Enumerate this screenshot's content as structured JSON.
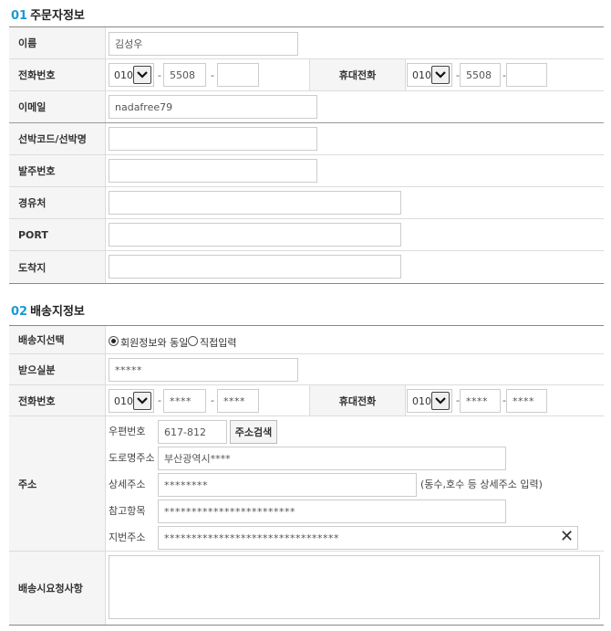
{
  "orderer": {
    "num": "01",
    "title": "주문자정보",
    "name_label": "이름",
    "name_value": "김성우",
    "phone_label": "전화번호",
    "phone": {
      "area": "010",
      "mid": "5508",
      "last": ""
    },
    "mobile_label": "휴대전화",
    "mobile": {
      "area": "010",
      "mid": "5508",
      "last": ""
    },
    "email_label": "이메일",
    "email_value": "nadafree79",
    "ship_code_label": "선박코드/선박명",
    "ship_code_value": "",
    "order_no_label": "발주번호",
    "order_no_value": "",
    "via_label": "경유처",
    "via_value": "",
    "port_label": "PORT",
    "port_value": "",
    "dest_label": "도착지",
    "dest_value": ""
  },
  "shipping": {
    "num": "02",
    "title": "배송지정보",
    "select_label": "배송지선택",
    "option_same": "회원정보와 동일",
    "option_direct": "직접입력",
    "selected": "same",
    "recipient_label": "받으실분",
    "recipient_value": "*****",
    "phone_label": "전화번호",
    "phone": {
      "area": "010",
      "mid": "****",
      "last": "****"
    },
    "mobile_label": "휴대전화",
    "mobile": {
      "area": "010",
      "mid": "****",
      "last": "****"
    },
    "address_label": "주소",
    "zip_label": "우편번호",
    "zip_value": "617-812",
    "zip_button": "주소검색",
    "road_label": "도로명주소",
    "road_value": "부산광역시****",
    "detail_label": "상세주소",
    "detail_value": "********",
    "detail_note": "(동수,호수 등 상세주소 입력)",
    "ref_label": "참고항목",
    "ref_value": "************************",
    "jibun_label": "지번주소",
    "jibun_value": "********************************",
    "request_label": "배송시요청사항",
    "request_value": ""
  },
  "icons": {
    "select_arrow": "chevron-down-icon",
    "clear": "close-icon"
  }
}
